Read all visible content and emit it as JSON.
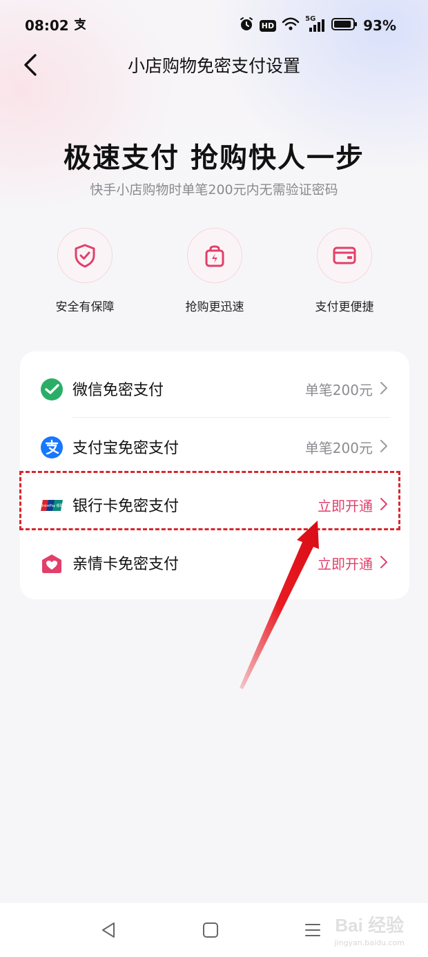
{
  "status_bar": {
    "time": "08:02",
    "app_icon": "alipay-glyph-icon",
    "hd_label": "HD",
    "network_label": "5G",
    "battery_percent": "93%",
    "battery_level": 0.93
  },
  "header": {
    "title": "小店购物免密支付设置",
    "back_icon": "back-arrow-icon"
  },
  "hero": {
    "title": "极速支付  抢购快人一步",
    "subtitle": "快手小店购物时单笔200元内无需验证密码"
  },
  "features": [
    {
      "label": "安全有保障",
      "icon": "shield-check-icon"
    },
    {
      "label": "抢购更迅速",
      "icon": "bag-lightning-icon"
    },
    {
      "label": "支付更便捷",
      "icon": "card-icon"
    }
  ],
  "payment_methods": [
    {
      "label": "微信免密支付",
      "value": "单笔200元",
      "status": "enabled",
      "icon": "wechat-icon"
    },
    {
      "label": "支付宝免密支付",
      "value": "单笔200元",
      "status": "enabled",
      "icon": "alipay-icon"
    },
    {
      "label": "银行卡免密支付",
      "value": "立即开通",
      "status": "action",
      "icon": "unionpay-icon",
      "icon_text": "UnionPay 银联"
    },
    {
      "label": "亲情卡免密支付",
      "value": "立即开通",
      "status": "action",
      "icon": "family-card-icon"
    }
  ],
  "colors": {
    "accent": "#e23f6a",
    "annotation_red": "#d8262e",
    "wechat_green": "#2aae67",
    "alipay_blue": "#1677ff"
  },
  "bottom_nav": {
    "buttons": [
      "back-triangle-icon",
      "home-square-icon",
      "menu-lines-icon"
    ],
    "watermark": "Bai 经验",
    "watermark_sub": "jingyan.baidu.com"
  }
}
